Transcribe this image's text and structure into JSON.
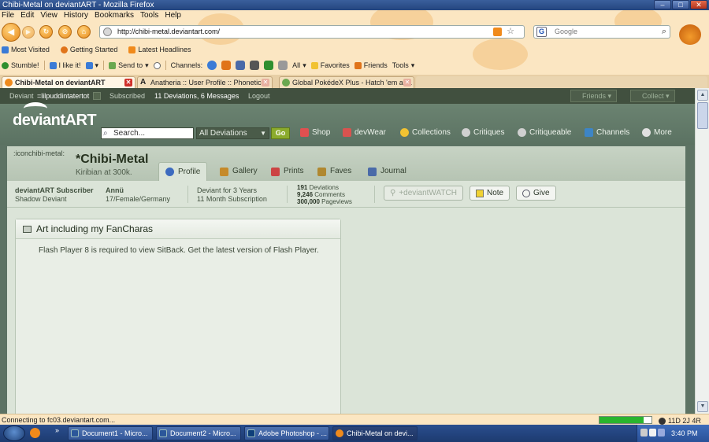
{
  "window": {
    "title": "Chibi-Metal on deviantART - Mozilla Firefox",
    "controls": {
      "minimize": "–",
      "maximize": "□",
      "close": "✕"
    }
  },
  "menu": [
    "File",
    "Edit",
    "View",
    "History",
    "Bookmarks",
    "Tools",
    "Help"
  ],
  "address": {
    "url": "http://chibi-metal.deviantart.com/"
  },
  "search": {
    "engine_glyph": "G",
    "placeholder": "Google"
  },
  "bookmarks": [
    {
      "label": "Most Visited",
      "color": "#3b7bd6"
    },
    {
      "label": "Getting Started",
      "color": "#e0741a"
    },
    {
      "label": "Latest Headlines",
      "color": "#f08a1c"
    }
  ],
  "toolbar2": {
    "stumble": "Stumble!",
    "ilike": "I like it!",
    "sendto": "Send to",
    "channels": "Channels:",
    "all": "All",
    "favorites": "Favorites",
    "friends": "Friends",
    "tools": "Tools"
  },
  "tabs": [
    {
      "label": "Chibi-Metal on deviantART",
      "color": "#f08a1c",
      "active": true
    },
    {
      "label": "Anatheria :: User Profile :: Phonetic",
      "color": "#222222",
      "active": false
    },
    {
      "label": "Global PokédeX Plus - Hatch 'em all...",
      "color": "#6aa84f",
      "active": false
    }
  ],
  "userbar": {
    "deviant_label": "Deviant",
    "deviant_name": "=lilpuddintatertot",
    "subscribed": "Subscribed",
    "counts": "11 Deviations, 6 Messages",
    "logout": "Logout",
    "friends": "Friends",
    "collect": "Collect"
  },
  "da_header": {
    "logo": "deviantART",
    "search_placeholder": "Search...",
    "scope": "All Deviations",
    "go": "Go",
    "nav": [
      {
        "label": "Shop",
        "color": "#e05050"
      },
      {
        "label": "devWear",
        "color": "#d9534f"
      },
      {
        "label": "Collections",
        "color": "#f1c232"
      },
      {
        "label": "Critiques",
        "color": "#d0d0d0"
      },
      {
        "label": "Critiqueable",
        "color": "#d0d0d0"
      },
      {
        "label": "Channels",
        "color": "#3d85c6"
      },
      {
        "label": "More",
        "color": "#e0e0e0"
      }
    ]
  },
  "profile": {
    "icon_alt": ":iconchibi-metal:",
    "name": "*Chibi-Metal",
    "tagline": "Kiribian at 300k.",
    "tabs": [
      {
        "label": "Profile",
        "color": "#3d6bbf",
        "active": true
      },
      {
        "label": "Gallery",
        "color": "#c58a2a",
        "active": false
      },
      {
        "label": "Prints",
        "color": "#cc4444",
        "active": false
      },
      {
        "label": "Faves",
        "color": "#b08830",
        "active": false
      },
      {
        "label": "Journal",
        "color": "#4a6aa8",
        "active": false
      }
    ],
    "stats": {
      "member_type": "deviantART Subscriber",
      "member_sub": "Shadow Deviant",
      "real_name": "Annü",
      "bio": "17/Female/Germany",
      "years": "Deviant for 3 Years",
      "subscription": "11 Month Subscription",
      "deviations": "191",
      "deviations_label": "Deviations",
      "comments": "9,246",
      "comments_label": "Comments",
      "pageviews": "300,000",
      "pageviews_label": "Pageviews"
    },
    "buttons": {
      "watch": "+deviantWATCH",
      "note": "Note",
      "give": "Give"
    }
  },
  "art_box": {
    "title": "Art including my FanCharas",
    "body": "Flash Player 8 is required to view SitBack. Get the latest version of Flash Player."
  },
  "statusbar": {
    "text": "Connecting to fc03.deviantart.com...",
    "progress_fraction": 0.85,
    "addon": "11D 2J 4R"
  },
  "taskbar": {
    "tasks": [
      {
        "label": "Document1 - Micro...",
        "color": "#2b579a"
      },
      {
        "label": "Document2 - Micro...",
        "color": "#2b579a"
      },
      {
        "label": "Adobe Photoshop - ...",
        "color": "#0e3f7a"
      },
      {
        "label": "Chibi-Metal on devi...",
        "color": "#f08a1c"
      }
    ],
    "clock": "3:40 PM"
  }
}
